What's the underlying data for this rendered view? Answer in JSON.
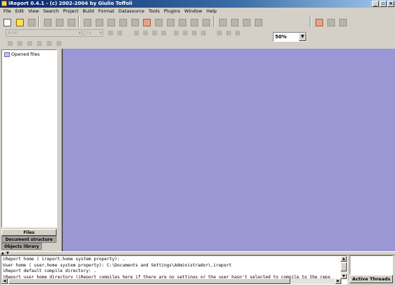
{
  "window": {
    "title": "iReport 0.4.1  - (c) 2002-2004 by Giulio Toffoli",
    "minimize": "_",
    "restore": "▫",
    "close": "×"
  },
  "menu": [
    "File",
    "Edit",
    "View",
    "Search",
    "Project",
    "Build",
    "Format",
    "Datasource",
    "Tools",
    "Plugins",
    "Window",
    "Help"
  ],
  "toolbar": {
    "zoom_value": "50%",
    "font_name": "Arial",
    "font_size": "14"
  },
  "left_panel": {
    "tree_root": "Opened files",
    "tabs": {
      "files": "Files",
      "document_structure": "Document structure",
      "objects_library": "Objects library"
    }
  },
  "log": {
    "lines": [
      "iReport home ( ireport.home system property): .",
      "User home ( user.home system property): C:\\Documents and Settings\\Administrador\\.ireport",
      "iReport default compile directory: .",
      "iReport user home directory (iReport compiles here if there are no settings or the user hasn't selected to compile to the repo"
    ]
  },
  "threads": {
    "button_label": "Active Threads"
  },
  "colors": {
    "workspace": "#9a98d4",
    "chrome": "#d4d0c8",
    "titlebar_start": "#0a246a"
  }
}
